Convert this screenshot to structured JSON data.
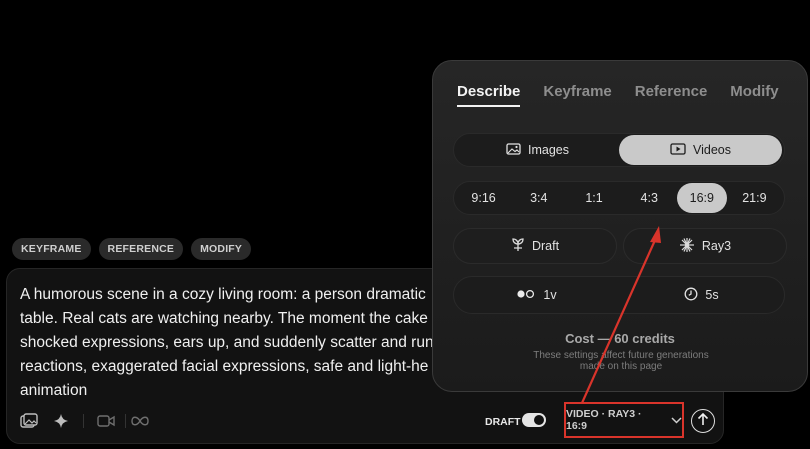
{
  "chips": [
    "KEYFRAME",
    "REFERENCE",
    "MODIFY"
  ],
  "prompt": {
    "lines": [
      "A humorous scene in a cozy living room: a person dramatic",
      "table. Real cats are watching nearby. The moment the cake",
      "shocked expressions, ears up, and suddenly scatter and run",
      "reactions, exaggerated facial expressions, safe and light-he",
      "animation"
    ]
  },
  "toolbar": {
    "draft_label": "DRAFT",
    "draft_on": true,
    "settings_label": "VIDEO · RAY3 · 16:9",
    "icons": [
      "image-icon",
      "sparkle-icon",
      "video-camera-icon",
      "infinity-icon",
      "chevron-down-icon",
      "upload-arrow-icon"
    ]
  },
  "popover": {
    "tabs": [
      "Describe",
      "Keyframe",
      "Reference",
      "Modify"
    ],
    "active_tab": "Describe",
    "media": {
      "options": [
        "Images",
        "Videos"
      ],
      "selected": "Videos"
    },
    "ratios": {
      "options": [
        "9:16",
        "3:4",
        "1:1",
        "4:3",
        "16:9",
        "21:9"
      ],
      "selected": "16:9"
    },
    "quality": {
      "label": "Draft"
    },
    "model": {
      "label": "Ray3"
    },
    "variations": {
      "label": "1v"
    },
    "duration": {
      "label": "5s"
    },
    "cost": "Cost — 60 credits",
    "note": "These settings affect future generations made on this page"
  },
  "colors": {
    "highlight_red": "#d9342b",
    "selected_pill": "#c9c9c9"
  }
}
